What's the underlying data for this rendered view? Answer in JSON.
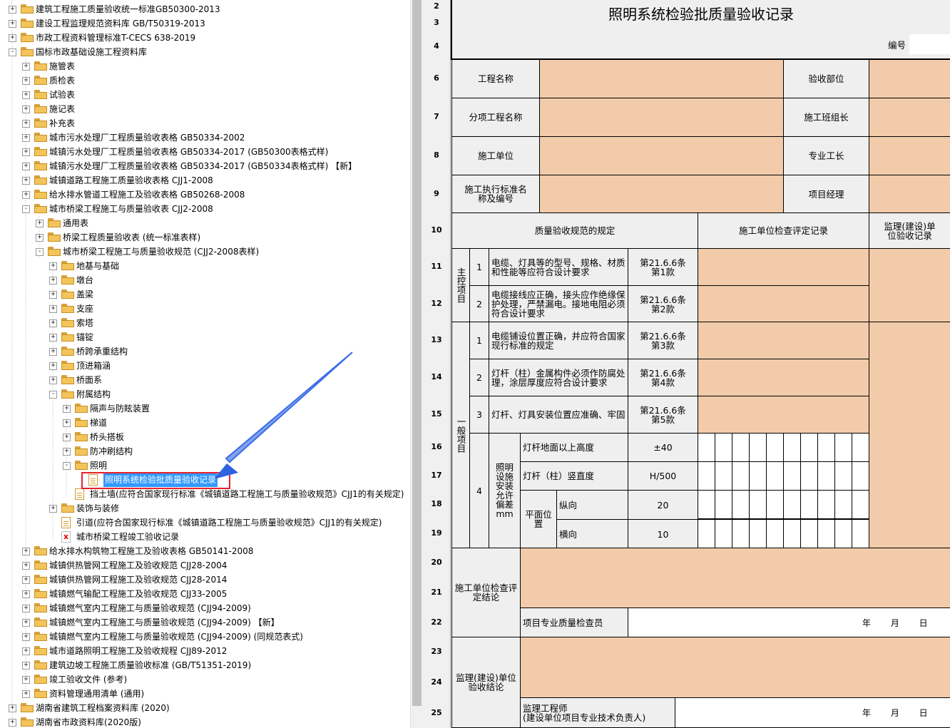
{
  "tree": {
    "nodes": [
      {
        "label": "建筑工程施工质量验收统一标准GB50300-2013",
        "depth": 0,
        "icon": "folder",
        "toggle": "+"
      },
      {
        "label": "建设工程监理规范资料库 GB/T50319-2013",
        "depth": 0,
        "icon": "folder",
        "toggle": "+"
      },
      {
        "label": "市政工程资料管理标准T-CECS 638-2019",
        "depth": 0,
        "icon": "folder",
        "toggle": "+"
      },
      {
        "label": "国标市政基础设施工程资料库",
        "depth": 0,
        "icon": "folder",
        "toggle": "-"
      },
      {
        "label": "施管表",
        "depth": 1,
        "icon": "folder",
        "toggle": "+"
      },
      {
        "label": "质检表",
        "depth": 1,
        "icon": "folder",
        "toggle": "+"
      },
      {
        "label": "试验表",
        "depth": 1,
        "icon": "folder",
        "toggle": "+"
      },
      {
        "label": "施记表",
        "depth": 1,
        "icon": "folder",
        "toggle": "+"
      },
      {
        "label": "补充表",
        "depth": 1,
        "icon": "folder",
        "toggle": "+"
      },
      {
        "label": "城市污水处理厂工程质量验收表格 GB50334-2002",
        "depth": 1,
        "icon": "folder",
        "toggle": "+"
      },
      {
        "label": "城镇污水处理厂工程质量验收表格 GB50334-2017 (GB50300表格式样)",
        "depth": 1,
        "icon": "folder",
        "toggle": "+"
      },
      {
        "label": "城镇污水处理厂工程质量验收表格 GB50334-2017 (GB50334表格式样) 【新】",
        "depth": 1,
        "icon": "folder",
        "toggle": "+"
      },
      {
        "label": "城镇道路工程施工质量验收表格 CJJ1-2008",
        "depth": 1,
        "icon": "folder",
        "toggle": "+"
      },
      {
        "label": "给水排水管道工程施工及验收表格 GB50268-2008",
        "depth": 1,
        "icon": "folder",
        "toggle": "+"
      },
      {
        "label": "城市桥梁工程施工与质量验收表 CJJ2-2008",
        "depth": 1,
        "icon": "folder",
        "toggle": "-"
      },
      {
        "label": "通用表",
        "depth": 2,
        "icon": "folder",
        "toggle": "+"
      },
      {
        "label": "桥梁工程质量验收表 (统一标准表样)",
        "depth": 2,
        "icon": "folder",
        "toggle": "+"
      },
      {
        "label": "城市桥梁工程施工与质量验收规范 (CJJ2-2008表样)",
        "depth": 2,
        "icon": "folder",
        "toggle": "-"
      },
      {
        "label": "地基与基础",
        "depth": 3,
        "icon": "folder",
        "toggle": "+"
      },
      {
        "label": "墩台",
        "depth": 3,
        "icon": "folder",
        "toggle": "+"
      },
      {
        "label": "盖梁",
        "depth": 3,
        "icon": "folder",
        "toggle": "+"
      },
      {
        "label": "支座",
        "depth": 3,
        "icon": "folder",
        "toggle": "+"
      },
      {
        "label": "索塔",
        "depth": 3,
        "icon": "folder",
        "toggle": "+"
      },
      {
        "label": "锚锭",
        "depth": 3,
        "icon": "folder",
        "toggle": "+"
      },
      {
        "label": "桥跨承重结构",
        "depth": 3,
        "icon": "folder",
        "toggle": "+"
      },
      {
        "label": "顶进箱涵",
        "depth": 3,
        "icon": "folder",
        "toggle": "+"
      },
      {
        "label": "桥面系",
        "depth": 3,
        "icon": "folder",
        "toggle": "+"
      },
      {
        "label": "附属结构",
        "depth": 3,
        "icon": "folder",
        "toggle": "-"
      },
      {
        "label": "隔声与防眩装置",
        "depth": 4,
        "icon": "folder",
        "toggle": "+"
      },
      {
        "label": "梯道",
        "depth": 4,
        "icon": "folder",
        "toggle": "+"
      },
      {
        "label": "桥头搭板",
        "depth": 4,
        "icon": "folder",
        "toggle": "+"
      },
      {
        "label": "防冲刷结构",
        "depth": 4,
        "icon": "folder",
        "toggle": "+"
      },
      {
        "label": "照明",
        "depth": 4,
        "icon": "folder",
        "toggle": "-"
      },
      {
        "label": "照明系统检验批质量验收记录",
        "depth": 5,
        "icon": "doc",
        "toggle": "",
        "prefix": "检",
        "selected": true
      },
      {
        "label": "挡土墙(应符合国家现行标准《城镇道路工程施工与质量验收规范》CJJ1的有关规定)",
        "depth": 4,
        "icon": "doc",
        "toggle": ""
      },
      {
        "label": "装饰与装修",
        "depth": 3,
        "icon": "folder",
        "toggle": "+"
      },
      {
        "label": "引道(应符合国家现行标准《城镇道路工程施工与质量验收规范》CJJ1的有关规定)",
        "depth": 3,
        "icon": "doc",
        "toggle": ""
      },
      {
        "label": "城市桥梁工程竣工验收记录",
        "depth": 3,
        "icon": "x",
        "toggle": ""
      },
      {
        "label": "给水排水构筑物工程施工及验收表格 GB50141-2008",
        "depth": 1,
        "icon": "folder",
        "toggle": "+"
      },
      {
        "label": "城镇供热管网工程施工及验收规范 CJJ28-2004",
        "depth": 1,
        "icon": "folder",
        "toggle": "+"
      },
      {
        "label": "城镇供热管网工程施工及验收规范 CJJ28-2014",
        "depth": 1,
        "icon": "folder",
        "toggle": "+"
      },
      {
        "label": "城镇燃气输配工程施工及验收规范 CJJ33-2005",
        "depth": 1,
        "icon": "folder",
        "toggle": "+"
      },
      {
        "label": "城镇燃气室内工程施工与质量验收规范 (CJJ94-2009)",
        "depth": 1,
        "icon": "folder",
        "toggle": "+"
      },
      {
        "label": "城镇燃气室内工程施工与质量验收规范 (CJJ94-2009) 【新】",
        "depth": 1,
        "icon": "folder",
        "toggle": "+"
      },
      {
        "label": "城镇燃气室内工程施工与质量验收规范 (CJJ94-2009) (同规范表式)",
        "depth": 1,
        "icon": "folder",
        "toggle": "+"
      },
      {
        "label": "城市道路照明工程施工及验收规程 CJJ89-2012",
        "depth": 1,
        "icon": "folder",
        "toggle": "+"
      },
      {
        "label": "建筑边坡工程施工质量验收标准 (GB/T51351-2019)",
        "depth": 1,
        "icon": "folder",
        "toggle": "+"
      },
      {
        "label": "竣工验收文件 (参考)",
        "depth": 1,
        "icon": "folder",
        "toggle": "+"
      },
      {
        "label": "资料管理通用清单 (通用)",
        "depth": 1,
        "icon": "folder",
        "toggle": "+"
      },
      {
        "label": "湖南省建筑工程档案资料库 (2020)",
        "depth": 0,
        "icon": "folder",
        "toggle": "+"
      },
      {
        "label": "湖南省市政资料库(2020版)",
        "depth": 0,
        "icon": "folder",
        "toggle": "+"
      }
    ]
  },
  "sheet": {
    "title": "照明系统检验批质量验收记录",
    "number_label": "编号",
    "row_numbers": [
      "2",
      "3",
      "4",
      "6",
      "7",
      "8",
      "9",
      "10",
      "11",
      "12",
      "13",
      "14",
      "15",
      "16",
      "17",
      "18",
      "19",
      "20",
      "21",
      "22",
      "23",
      "24",
      "25"
    ],
    "labels": {
      "project_name": "工程名称",
      "acceptance_part": "验收部位",
      "sub_project_name": "分项工程名称",
      "team_leader": "施工班组长",
      "construction_unit": "施工单位",
      "foreman": "专业工长",
      "standard": "施工执行标准名称及编号",
      "project_manager": "项目经理",
      "spec_header": "质量验收规范的规定",
      "check_header": "施工单位检查评定记录",
      "supervision_header": "监理(建设)单位验收记录",
      "main_control": "主控项目",
      "general": "一般项目",
      "conclusion_construction": "施工单位检查评定结论",
      "inspector": "项目专业质量检查员",
      "date_ymd": "年 月 日",
      "conclusion_supervision": "监理(建设)单位验收结论",
      "engineer": "监理工程师",
      "engineer_sub": "(建设单位项目专业技术负责人)"
    },
    "main_items": [
      {
        "no": "1",
        "text": "电缆、灯具等的型号、规格、材质和性能等应符合设计要求",
        "clause": "第21.6.6条第1款"
      },
      {
        "no": "2",
        "text": "电缆接线应正确，接头应作绝缘保护处理，严禁漏电。接地电阻必须符合设计要求",
        "clause": "第21.6.6条第2款"
      }
    ],
    "general_items": [
      {
        "no": "1",
        "text": "电缆铺设位置正确，并应符合国家现行标准的规定",
        "clause": "第21.6.6条第3款"
      },
      {
        "no": "2",
        "text": "灯杆（柱）金属构件必须作防腐处理，涂层厚度应符合设计要求",
        "clause": "第21.6.6条第4款"
      },
      {
        "no": "3",
        "text": "灯杆、灯具安装位置应准确、牢固",
        "clause": "第21.6.6条第5款"
      }
    ],
    "tolerance": {
      "no": "4",
      "group_label": "照明设施安装允许偏差mm",
      "rows": [
        {
          "label": "灯杆地面以上高度",
          "value": "±40"
        },
        {
          "label": "灯杆（柱）竖直度",
          "value": "H/500"
        }
      ],
      "plane_label": "平面位置",
      "plane_rows": [
        {
          "label": "纵向",
          "value": "20"
        },
        {
          "label": "横向",
          "value": "10"
        }
      ]
    }
  }
}
